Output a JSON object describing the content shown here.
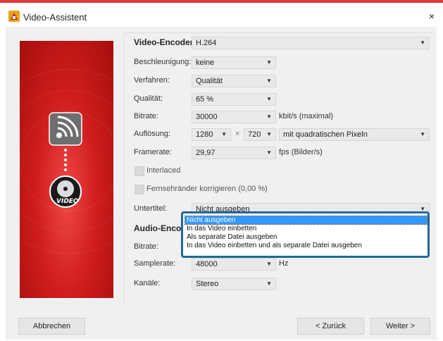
{
  "window": {
    "title": "Video-Assistent",
    "close_glyph": "×"
  },
  "banner": {
    "video_label": "VIDEO"
  },
  "video": {
    "encoder_label": "Video-Encoder:",
    "encoder_value": "H.264",
    "acceleration_label": "Beschleunigung:",
    "acceleration_value": "keine",
    "method_label": "Verfahren:",
    "method_value": "Qualität",
    "quality_label": "Qualität:",
    "quality_value": "65 %",
    "bitrate_label": "Bitrate:",
    "bitrate_value": "30000",
    "bitrate_unit": "kbit/s (maximal)",
    "resolution_label": "Auflösung:",
    "res_width": "1280",
    "res_times": "×",
    "res_height": "720",
    "pixel_mode": "mit quadratischen Pixeln",
    "framerate_label": "Framerate:",
    "framerate_value": "29,97",
    "framerate_unit": "fps (Bilder/s)",
    "interlaced_label": "Interlaced",
    "tvedges_label": "Fernsehränder korrigieren (0,00 %)",
    "subtitle_label": "Untertitel:",
    "subtitle_value": "Nicht ausgeben"
  },
  "audio": {
    "encoder_label": "Audio-Encode",
    "bitrate_label": "Bitrate:",
    "samplerate_label": "Samplerate:",
    "samplerate_value": "48000",
    "samplerate_unit": "Hz",
    "channels_label": "Kanäle:",
    "channels_value": "Stereo"
  },
  "subtitle_options": [
    "Nicht ausgeben",
    "In das Video einbetten",
    "Als separate Datei ausgeben",
    "In das Video einbetten und als separate Datei ausgeben"
  ],
  "subtitle_selected": "Nicht ausgeben",
  "footer": {
    "cancel_label": "Abbrechen",
    "back_label": "< Zurück",
    "next_label": "Weiter >"
  },
  "colors": {
    "accent_red": "#d11d1d",
    "selection_blue": "#3399ff",
    "popup_border": "#1e6a9a"
  }
}
